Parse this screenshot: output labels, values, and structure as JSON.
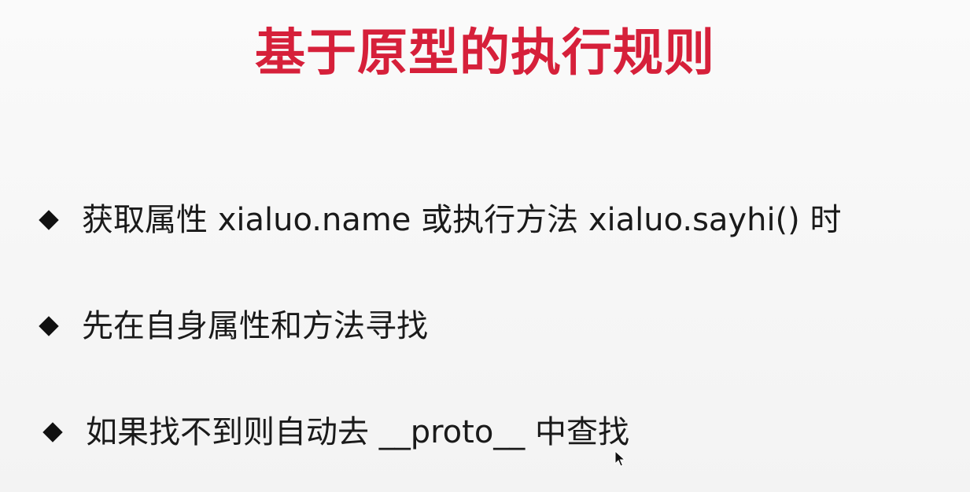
{
  "slide": {
    "title": "基于原型的执行规则",
    "bullets": [
      {
        "text": "获取属性 xialuo.name 或执行方法 xialuo.sayhi()  时"
      },
      {
        "text": "先在自身属性和方法寻找"
      },
      {
        "text": "如果找不到则自动去 __proto__ 中查找"
      }
    ],
    "colors": {
      "title": "#d6203a",
      "text": "#1a1a1a",
      "background": "#f6f6f6"
    },
    "icons": {
      "bullet": "diamond-bullet-icon",
      "pointer": "mouse-pointer-icon"
    }
  }
}
